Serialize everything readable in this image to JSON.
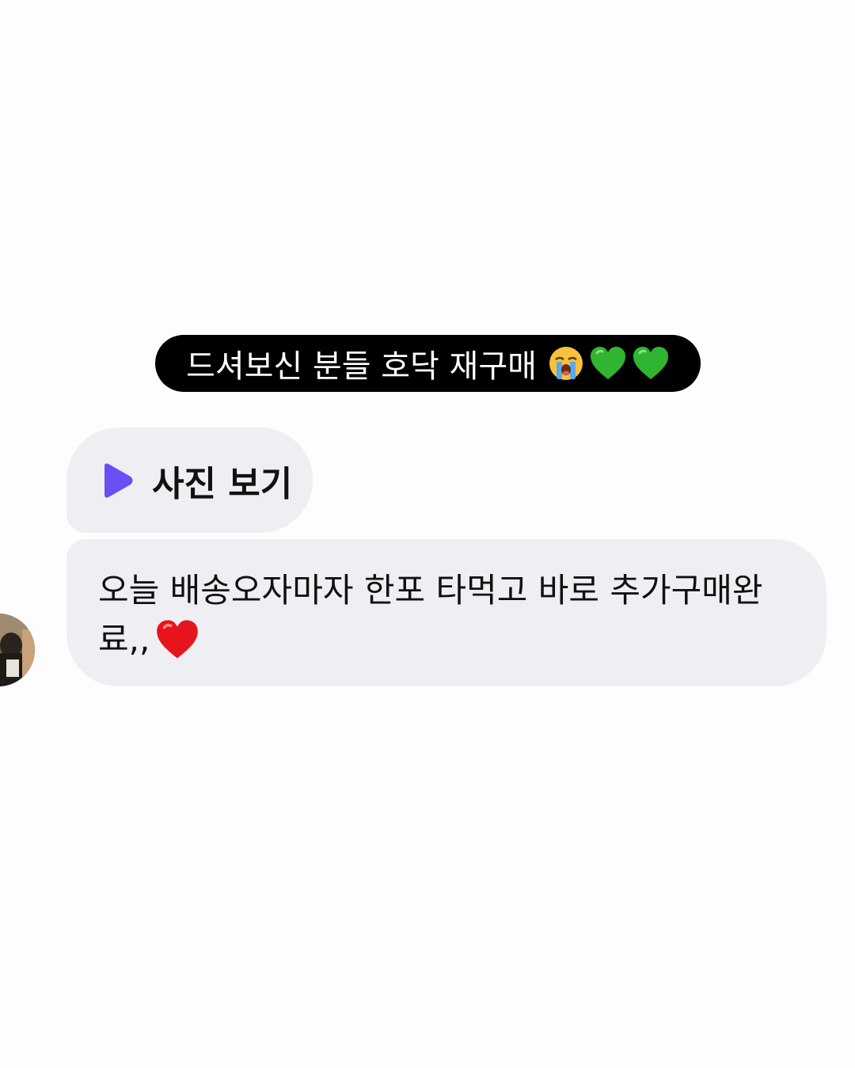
{
  "caption": {
    "text": "드셔보신 분들 호닥 재구매",
    "emoji": [
      "loudly-crying-face-emoji",
      "green-heart-emoji",
      "green-heart-emoji"
    ]
  },
  "photo_button": {
    "label": "사진 보기",
    "icon": "play-icon",
    "icon_color": "#6a4ff5"
  },
  "message": {
    "line1": "오늘 배송오자마자 한포 타먹고 바로 추가구매완",
    "line2": "료,,",
    "emoji": "red-heart-emoji"
  },
  "colors": {
    "bubble": "#efeff3",
    "caption_bg": "#000000",
    "caption_text": "#ffffff"
  }
}
